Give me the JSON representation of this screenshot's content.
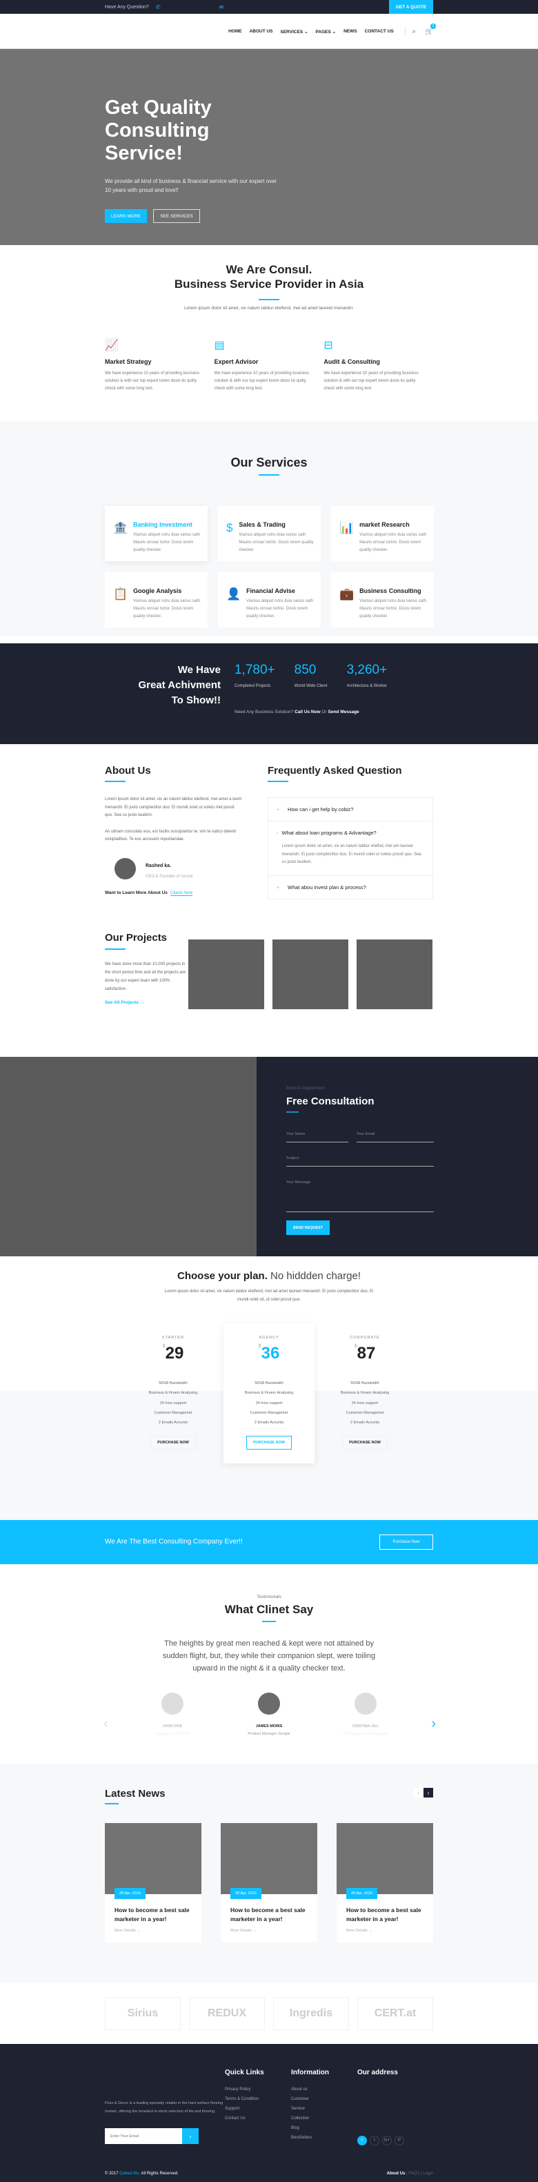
{
  "colors": {
    "accent": "#10bfff",
    "dark": "#1e2231",
    "placeholder": "#737373"
  },
  "topbar": {
    "question": "Have Any Question?",
    "phone_icon": "phone-icon",
    "mail_icon": "mail-icon",
    "quote_button": "GET A QUOTE"
  },
  "nav": {
    "items": [
      "HOME",
      "ABOUT US",
      "SERVICES",
      "PAGES",
      "NEWS",
      "CONTACT US"
    ],
    "cart_count": "0"
  },
  "hero": {
    "title": "Get Quality Consulting Service!",
    "text": "We provide all kind of business & financial service with our expert over 10 years with proud and love!!",
    "learn_more": "LEARN MORE",
    "see_services": "SEE SERVICES"
  },
  "intro": {
    "title1": "We Are Consul.",
    "title2": "Business Service Provider in Asia",
    "lead": "Lorem ipsum dolor sit amet, vix natum labitur eleifend, mel ad amet laoreet menandri.",
    "features": [
      {
        "title": "Market Strategy",
        "icon": "presentation-chart-icon",
        "text": "We have experience 10 years of providing business solution & with our top expert lorem dosis lio qulity check with some long text."
      },
      {
        "title": "Expert Advisor",
        "icon": "document-icon",
        "text": "We have experience 10 years of providing business solution & with our top expert lorem dosis lio qulity check with some long text."
      },
      {
        "title": "Audit & Consulting",
        "icon": "briefcase-icon",
        "text": "We have experience 10 years of providing business solution & with our top expert lorem dosis lio qulity check with some long text."
      }
    ]
  },
  "services": {
    "title": "Our Services",
    "items": [
      {
        "title": "Banking Investment",
        "icon": "bank-icon",
        "text": "Viamus aliquet rutru duia varius sath Mauris ornoar tortor. Dosis lorem quality checker."
      },
      {
        "title": "Sales & Trading",
        "icon": "dollar-icon",
        "text": "Viamus aliquet rutru duia varius sath Mauris ornoar tortrio. Dosis lorem quality checker."
      },
      {
        "title": "market Research",
        "icon": "bar-chart-icon",
        "text": "Viamus aliquet rutru duia varius sath Mauris ornoar tortrio. Dosis lorem quality checker."
      },
      {
        "title": "Google Analysis",
        "icon": "clipboard-icon",
        "text": "Viamus aliquet rutru duia varius sath Mauris ornoar tortor. Dosis lorem quality checker."
      },
      {
        "title": "Financial Advise",
        "icon": "user-icon",
        "text": "Viamus aliquet rutru duia varius sath Mauris ornoar tortrio. Dosis lorem quality checker."
      },
      {
        "title": "Business Consulting",
        "icon": "briefcase-icon",
        "text": "Viamus aliquet rutru duia varius sath Mauris ornoar tortrio. Dosis lorem quality checker."
      }
    ]
  },
  "stats": {
    "title1": "We Have",
    "title2": "Great Achivment",
    "title3": "To Show!!",
    "items": [
      {
        "value": "1,780+",
        "label": "Completed Projects"
      },
      {
        "value": "850",
        "label": "World Wide Client"
      },
      {
        "value": "3,260+",
        "label": "Architecture & Worker"
      }
    ],
    "need": "Need Any Business Solution?",
    "call": "Call Us Now",
    "or": "Or",
    "send": "Send Message"
  },
  "about": {
    "title": "About Us",
    "p1": "Lorem ipsum dolor sit amet, vix an natum labitur eleifend, mel amet a laorit menandri. Ei justo complectitur duo. Ei mundi solet ut soletu mel possit quo. Sea cu justo laudem.",
    "p2": "An utinam consulatu eos, est facilis suscipiantur te, vim te iudico delenit voluptatibus. Te eos accusam repudiandae.",
    "name": "Rashed ka.",
    "role": "CEO & Founder of consul",
    "more": "Want to Learn More About Us",
    "link": "Clieck here"
  },
  "faq": {
    "title": "Frequently Asked Question",
    "items": [
      {
        "q": "How can i get help by cobiz?"
      },
      {
        "q": "What about loan programs & Advantage?",
        "a": "Lorem ipsum dolor sit amet, vix an natum labitur eleifnd, mel am laoreet menandri. Ei justo complectitur duo. Ei mundi solet ut soletu possit quo. Sea cu justo laudem."
      },
      {
        "q": "What abou invest plan & process?"
      }
    ]
  },
  "projects": {
    "title": "Our Projects",
    "text": "We have done more than 10,000 projects in the short period time and all the projects are done by our expert team with 100% satisfaction.",
    "link": "See All Projects →"
  },
  "consult": {
    "sub": "Book An Appoinment",
    "title": "Free Consultation",
    "name": "Your Name",
    "email": "Your Email",
    "subject": "Subject",
    "message": "Your Message",
    "button": "SEND REQUEST"
  },
  "pricing": {
    "title_bold": "Choose your plan.",
    "title_rest": "No hiddden charge!",
    "lead": "Lorem ipsum dolor sit amet, vix natum labitur eleifend, mel ad amet laoreet menandri. Ei justo complectitur duo. Ei mundi solet sit, ut solet possit quo.",
    "currency": "$",
    "plans": [
      {
        "name": "STARTER",
        "price": "29"
      },
      {
        "name": "AGENCY",
        "price": "36"
      },
      {
        "name": "CORPORATE",
        "price": "87"
      }
    ],
    "features": [
      "50GB Bandwidth",
      "Business & Financ Analysing",
      "24 hour support",
      "Customer Managemet",
      "2 Emails Acounts"
    ],
    "button": "PURCHASE NOW"
  },
  "banner": {
    "text": "We Are The Best Consulting Company Ever!!",
    "button": "Purchase Now"
  },
  "testimonials": {
    "sub": "Testimonials",
    "title": "What Clinet Say",
    "quote": "The heights by great men reached & kept were not attained by sudden flight, but, they while their companion slept, were toiling upward in the night & it a quality checker text.",
    "people": [
      {
        "name": "JHON DOE",
        "role": "Designer at Dribbble"
      },
      {
        "name": "JAMES MORIS",
        "role": "Product Manager Google"
      },
      {
        "name": "CRISTINA JILL",
        "role": "Photographer at Instagram"
      }
    ]
  },
  "news": {
    "title": "Latest News",
    "items": [
      {
        "date": "28 Apr, 2016",
        "title": "How to become a best sale marketer in a year!",
        "more": "More Details →"
      },
      {
        "date": "28 Apr, 2016",
        "title": "How to become a best sale marketer in a year!",
        "more": "More Details →"
      },
      {
        "date": "28 Apr, 2016",
        "title": "How to become a best sale marketer in a year!",
        "more": "More Details →"
      }
    ]
  },
  "logos": [
    "Sirius",
    "REDUX",
    "Ingredis",
    "CERT.at"
  ],
  "footer": {
    "about": "Floor & Decor is a leading specialty retailer in the hard surface flooring market, offering the broadest in-stock selection of tile,and flooring.",
    "email_placeholder": "Enter Your Email",
    "quick_title": "Quick Links",
    "quick": [
      "Privacy Policy",
      "Terms & Condition",
      "Support",
      "Contact Us"
    ],
    "info_title": "Information",
    "info": [
      "About us",
      "Customer",
      "Service",
      "Collection",
      "Blog",
      "BestSellers"
    ],
    "address_title": "Our address",
    "copy_pre": "© 2017",
    "copy_brand": "Consul Inc.",
    "copy_post": "All Rights Reserved.",
    "links": [
      "About Us",
      "FAQ's",
      "Login"
    ]
  }
}
